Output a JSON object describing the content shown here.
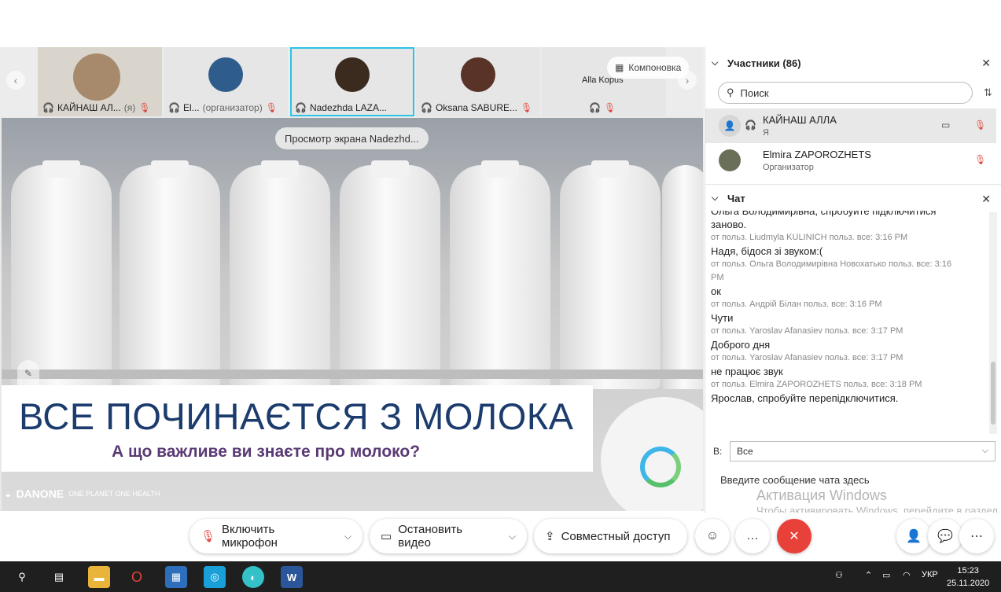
{
  "thumbnails": [
    {
      "name": "КАЙНАШ АЛ...",
      "role": "(я)"
    },
    {
      "name": "El...",
      "role": "(организатор)"
    },
    {
      "name": "Nadezhda LAZA...",
      "role": ""
    },
    {
      "name": "Oksana SABURE...",
      "role": ""
    },
    {
      "name": "Alla Kopus",
      "role": ""
    }
  ],
  "layout_button": "Компоновка",
  "view_pill": "Просмотр экрана Nadezhd...",
  "slide": {
    "title": "ВСЕ ПОЧИНАЄТСЯ З МОЛОКА",
    "subtitle": "А що важливе ви знаєте про молоко?",
    "brand": "DANONE",
    "brand_tag": "ONE PLANET  ONE HEALTH"
  },
  "participants": {
    "header": "Участники (86)",
    "search_placeholder": "Поиск",
    "list": [
      {
        "name": "КАЙНАШ АЛЛА",
        "sub": "Я"
      },
      {
        "name": "Elmira ZAPOROZHETS",
        "sub": "Организатор"
      }
    ]
  },
  "chat": {
    "header": "Чат",
    "messages": [
      {
        "text": "Ольга Володимирівна, спробуйте підключитися",
        "meta": ""
      },
      {
        "text": "заново.",
        "meta": ""
      },
      {
        "text": "",
        "meta": "от польз. Liudmyla KULINICH польз. все:    3:16 PM"
      },
      {
        "text": "Надя, бідося зі звуком:(",
        "meta": ""
      },
      {
        "text": "",
        "meta": "от польз. Ольга Володимирівна Новохатько польз. все:    3:16"
      },
      {
        "text": "",
        "meta": "PM"
      },
      {
        "text": "ок",
        "meta": ""
      },
      {
        "text": "",
        "meta": "от польз. Андрій Білан польз. все:    3:16 PM"
      },
      {
        "text": "Чути",
        "meta": ""
      },
      {
        "text": "",
        "meta": "от польз. Yaroslav Afanasiev польз. все:    3:17 PM"
      },
      {
        "text": "Доброго дня",
        "meta": ""
      },
      {
        "text": "",
        "meta": "от польз. Yaroslav Afanasiev польз. все:    3:17 PM"
      },
      {
        "text": "не працює звук",
        "meta": ""
      },
      {
        "text": "",
        "meta": "от польз. Elmira ZAPOROZHETS польз. все:    3:18 PM"
      },
      {
        "text": "Ярослав, спробуйте перепідключитися.",
        "meta": ""
      }
    ],
    "to_label": "В:",
    "to_value": "Все",
    "input_placeholder": "Введите сообщение чата здесь"
  },
  "windows_activation": {
    "title": "Активация Windows",
    "desc": "Чтобы активировать Windows, перейдите в раздел \"Параметры\"."
  },
  "toolbar": {
    "mic": "Включить микрофон",
    "video": "Остановить видео",
    "share": "Совместный доступ"
  },
  "taskbar": {
    "lang": "УКР",
    "time": "15:23",
    "date": "25.11.2020"
  }
}
